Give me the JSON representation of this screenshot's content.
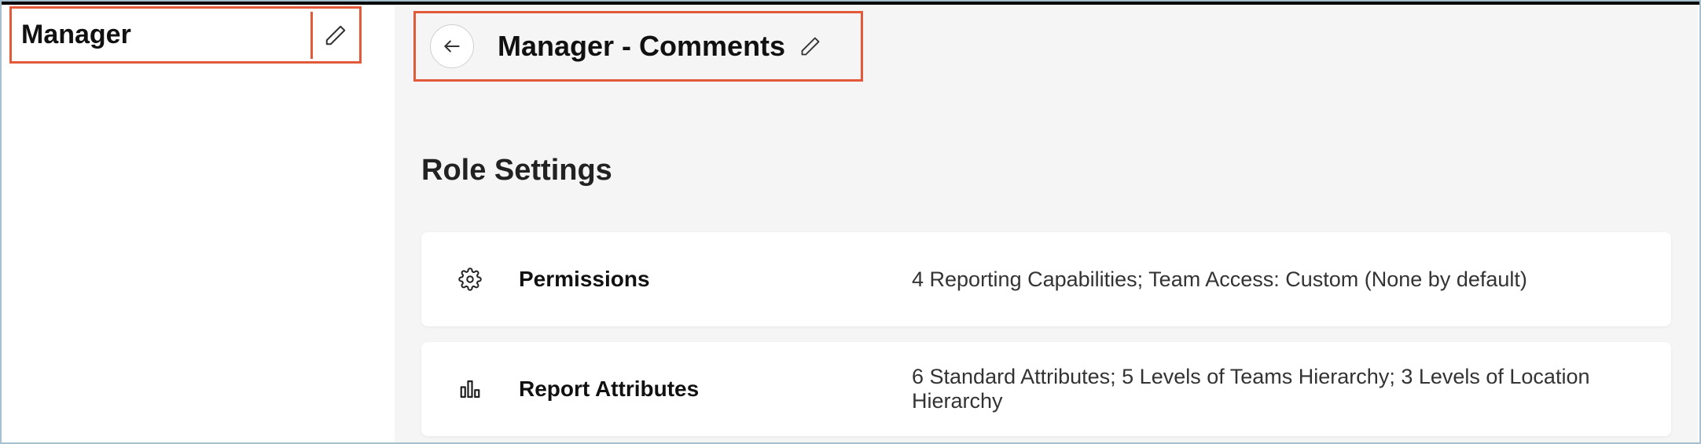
{
  "sidebar": {
    "item_label": "Manager"
  },
  "header": {
    "title": "Manager - Comments"
  },
  "section": {
    "title": "Role Settings"
  },
  "settings": {
    "permissions": {
      "label": "Permissions",
      "description": "4 Reporting Capabilities; Team Access: Custom (None by default)"
    },
    "report_attributes": {
      "label": "Report Attributes",
      "description": "6 Standard Attributes; 5 Levels of Teams Hierarchy; 3 Levels of Location Hierarchy"
    }
  }
}
